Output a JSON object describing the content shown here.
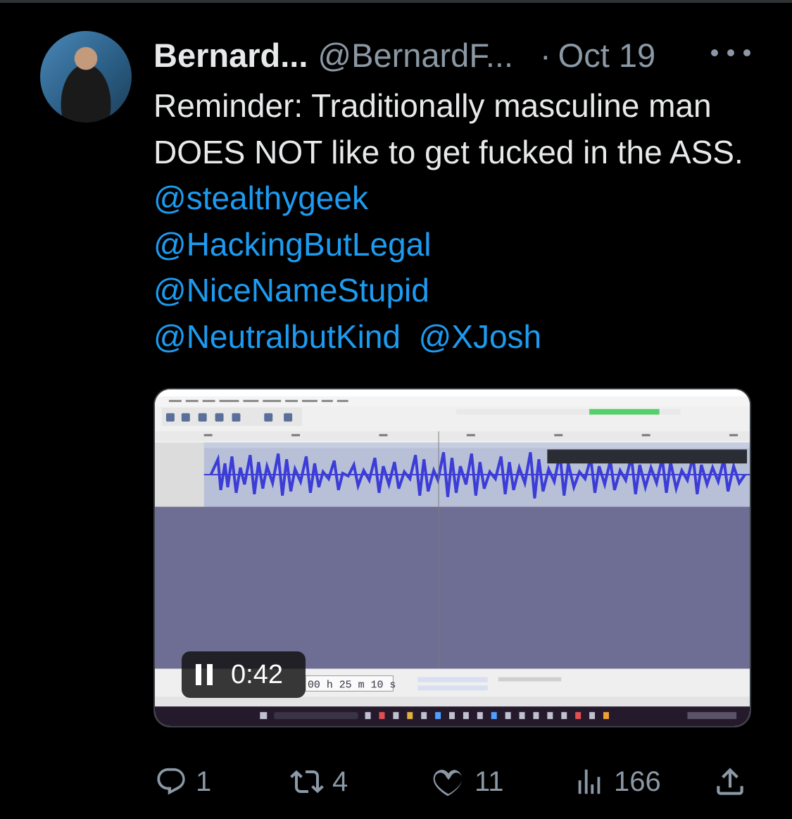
{
  "tweet": {
    "display_name": "Bernard...",
    "handle": "@BernardF...",
    "separator": "·",
    "date": "Oct 19",
    "text_plain": "Reminder: Traditionally masculine man DOES NOT like to get fucked in the ASS.",
    "mentions": [
      "@stealthygeek",
      "@HackingButLegal",
      "@NiceNameStupid",
      "@NeutralbutKind",
      "@XJosh"
    ]
  },
  "video": {
    "elapsed": "0:42",
    "audacity_timer": "00 h 25 m 10 s"
  },
  "actions": {
    "replies": "1",
    "reposts": "4",
    "likes": "11",
    "views": "166"
  },
  "icons": {
    "more": "more-icon",
    "reply": "reply-icon",
    "repost": "repost-icon",
    "like": "heart-icon",
    "views": "views-icon",
    "share": "share-icon",
    "pause": "pause-icon"
  },
  "colors": {
    "background": "#000000",
    "text": "#e7e9ea",
    "secondary": "#8b98a5",
    "link": "#1d9bf0",
    "waveform": "#3c3cd6"
  }
}
